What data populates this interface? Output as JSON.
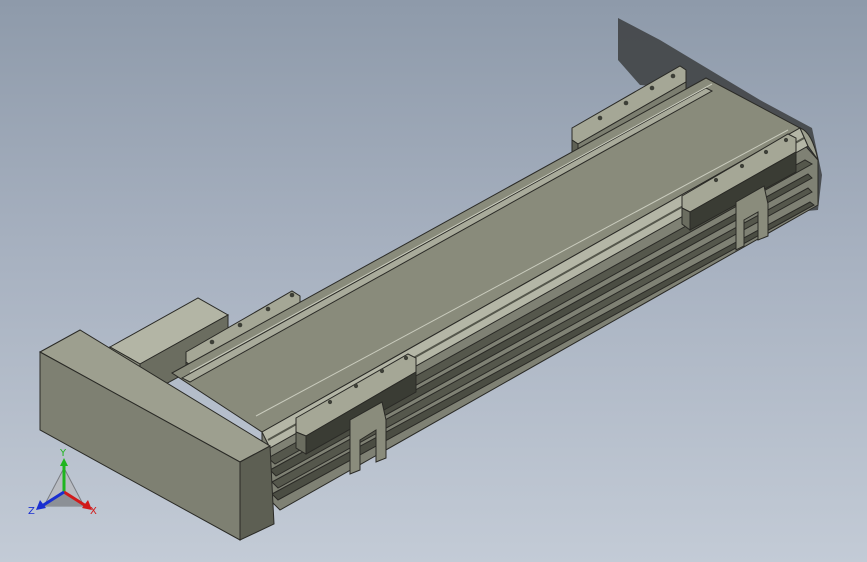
{
  "triad": {
    "x_label": "X",
    "y_label": "Y",
    "z_label": "Z",
    "x_color": "#d11a1a",
    "y_color": "#1fb51f",
    "z_color": "#1a2fd1"
  },
  "colors": {
    "background_top": "#8e9aaa",
    "background_bottom": "#c3cbd6",
    "body": "#8a8c7c",
    "body_light": "#a5a796",
    "body_dark": "#5f6155",
    "edge": "#2a2a26"
  }
}
